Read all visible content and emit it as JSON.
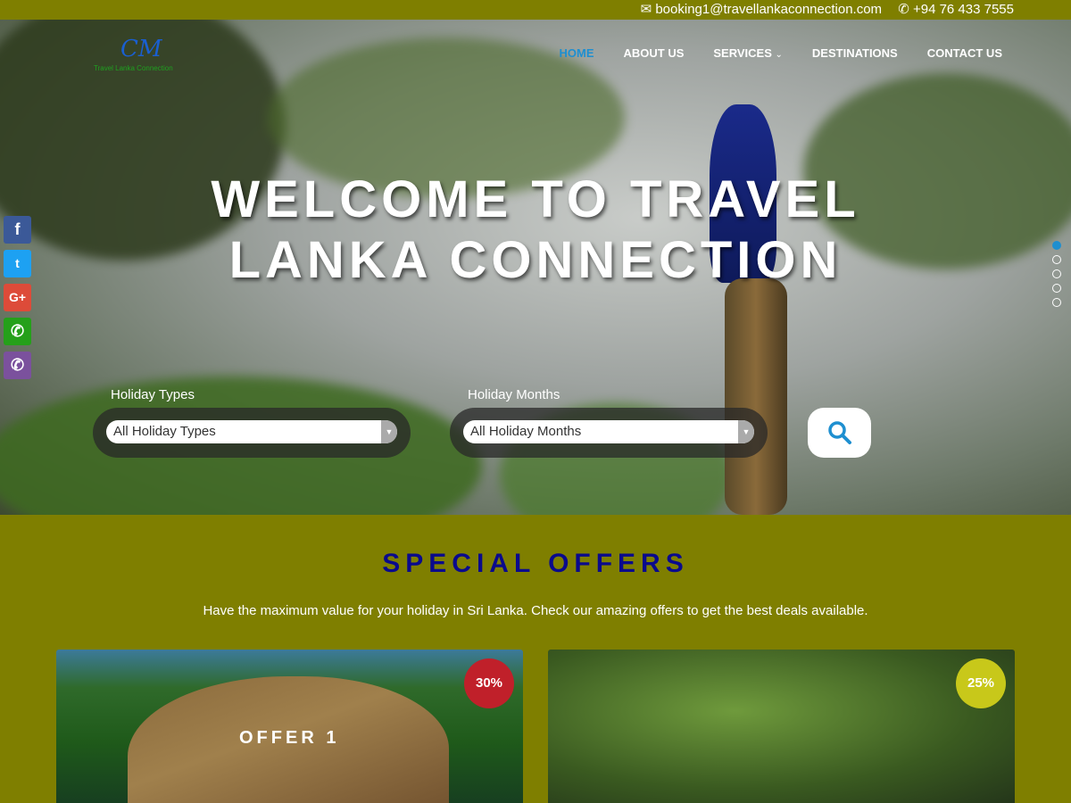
{
  "topbar": {
    "email": "booking1@travellankaconnection.com",
    "phone": "+94 76 433 7555"
  },
  "logo": {
    "mark": "CM",
    "text": "Travel Lanka Connection"
  },
  "nav": [
    {
      "label": "HOME"
    },
    {
      "label": "ABOUT US"
    },
    {
      "label": "SERVICES"
    },
    {
      "label": "DESTINATIONS"
    },
    {
      "label": "CONTACT US"
    }
  ],
  "hero": {
    "title_line1": "WELCOME TO TRAVEL",
    "title_line2": "LANKA CONNECTION",
    "slide_count": 5,
    "active_slide": 1
  },
  "search": {
    "types_label": "Holiday Types",
    "types_value": "All Holiday Types",
    "months_label": "Holiday Months",
    "months_value": "All Holiday Months"
  },
  "social": [
    "facebook",
    "twitter",
    "google-plus",
    "whatsapp",
    "viber"
  ],
  "offers": {
    "title": "SPECIAL OFFERS",
    "subtitle": "Have the maximum value for your holiday in Sri Lanka. Check our amazing offers to get the best deals available.",
    "cards": [
      {
        "name": "OFFER 1",
        "discount": "30%",
        "badge_color": "#c0202a"
      },
      {
        "name": "",
        "discount": "25%",
        "badge_color": "#c8c81a"
      }
    ]
  },
  "colors": {
    "brand": "#7f7f00",
    "title": "#0a0a8c",
    "accent": "#1e8fd0"
  }
}
